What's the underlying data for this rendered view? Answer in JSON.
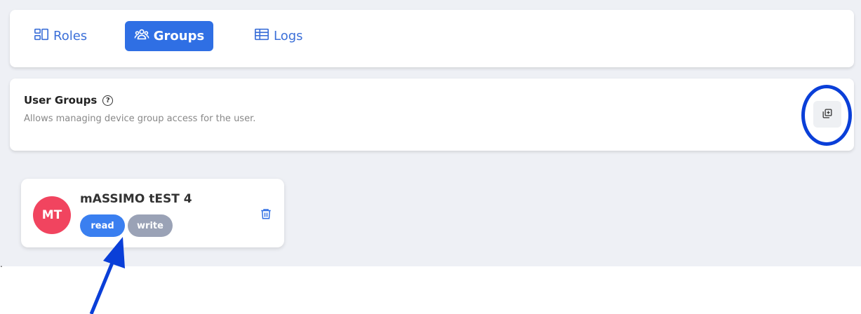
{
  "tabs": {
    "roles_label": "Roles",
    "groups_label": "Groups",
    "logs_label": "Logs"
  },
  "user_groups": {
    "title": "User Groups",
    "description": "Allows managing device group access for the user."
  },
  "user": {
    "initials": "MT",
    "name": "mASSIMO tEST 4",
    "permissions": [
      "read",
      "write"
    ]
  },
  "colors": {
    "accent": "#2f6fe4",
    "avatar": "#f1445f",
    "read_badge": "#3a7ff0",
    "write_badge": "#9aa2b6",
    "annotation": "#0a3fd8"
  },
  "icons": [
    "roles-icon",
    "groups-icon",
    "logs-icon",
    "help-icon",
    "add-group-icon",
    "trash-icon",
    "annotation-arrow",
    "annotation-circle"
  ],
  "misc": {
    "stray_dot": "."
  }
}
